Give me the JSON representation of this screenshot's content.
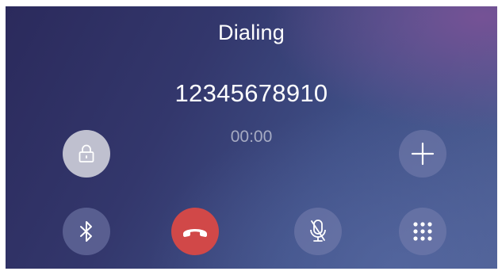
{
  "call": {
    "status": "Dialing",
    "number": "12345678910",
    "duration": "00:00"
  },
  "colors": {
    "background_start": "#2b2a5c",
    "background_end": "#4d5e93",
    "end_call": "#d14848",
    "lock_button": "#bfc0cf"
  },
  "controls": [
    {
      "name": "lock-button",
      "icon": "lock-icon"
    },
    {
      "name": "add-call-button",
      "icon": "plus-icon"
    },
    {
      "name": "bluetooth-button",
      "icon": "bluetooth-icon"
    },
    {
      "name": "end-call-button",
      "icon": "phone-hangup-icon"
    },
    {
      "name": "mute-button",
      "icon": "microphone-muted-icon"
    },
    {
      "name": "keypad-button",
      "icon": "keypad-icon"
    }
  ]
}
